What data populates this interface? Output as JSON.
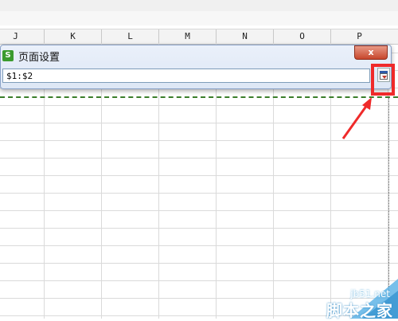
{
  "sheet": {
    "columns": [
      "J",
      "K",
      "L",
      "M",
      "N",
      "O",
      "P"
    ]
  },
  "dialog": {
    "title": "页面设置",
    "close_label": "x",
    "range_value": "$1:$2"
  },
  "watermark": {
    "url": "jb51.net",
    "brand": "脚本之家"
  },
  "colors": {
    "highlight": "#ef2a2a",
    "dashed_line": "#3a7d2a",
    "app_icon": "#3b9b2e"
  }
}
